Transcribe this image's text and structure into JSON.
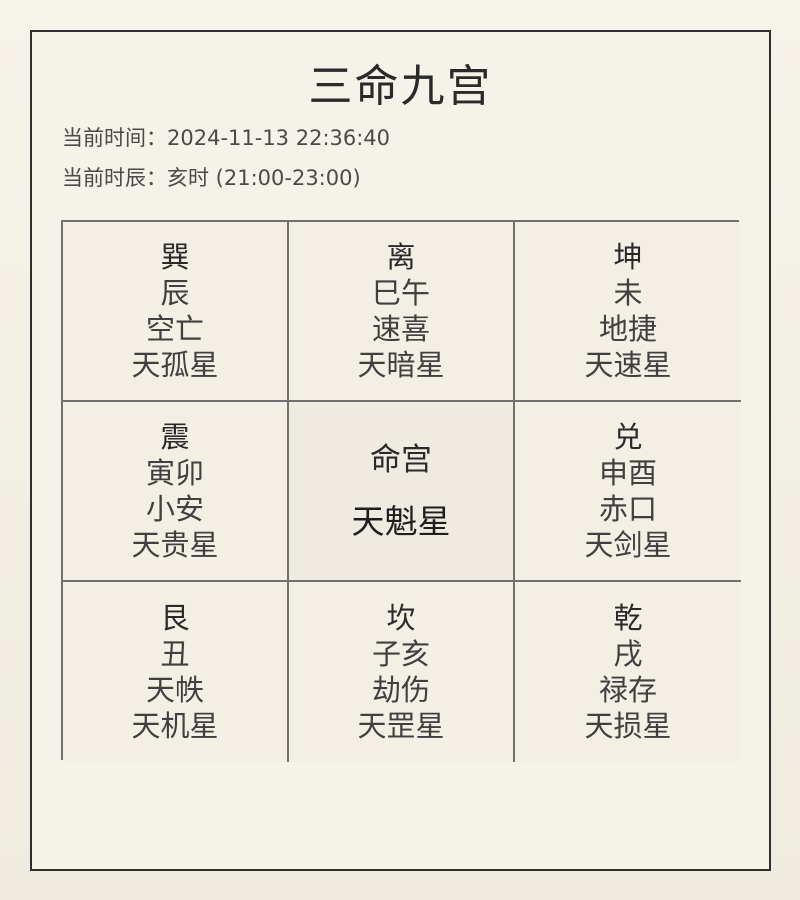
{
  "title": "三命九宫",
  "info": {
    "time_label": "当前时间：",
    "time_value": "2024-11-13 22:36:40",
    "shichen_label": "当前时辰：",
    "shichen_value": "亥时 (21:00-23:00)"
  },
  "grid": {
    "cells": [
      {
        "trigram": "巽",
        "branch": "辰",
        "omen": "空亡",
        "star": "天孤星"
      },
      {
        "trigram": "离",
        "branch": "巳午",
        "omen": "速喜",
        "star": "天暗星"
      },
      {
        "trigram": "坤",
        "branch": "未",
        "omen": "地捷",
        "star": "天速星"
      },
      {
        "trigram": "震",
        "branch": "寅卯",
        "omen": "小安",
        "star": "天贵星"
      },
      {
        "palace": "命宫",
        "star": "天魁星"
      },
      {
        "trigram": "兑",
        "branch": "申酉",
        "omen": "赤口",
        "star": "天剑星"
      },
      {
        "trigram": "艮",
        "branch": "丑",
        "omen": "天帙",
        "star": "天机星"
      },
      {
        "trigram": "坎",
        "branch": "子亥",
        "omen": "劫伤",
        "star": "天罡星"
      },
      {
        "trigram": "乾",
        "branch": "戌",
        "omen": "禄存",
        "star": "天损星"
      }
    ]
  }
}
